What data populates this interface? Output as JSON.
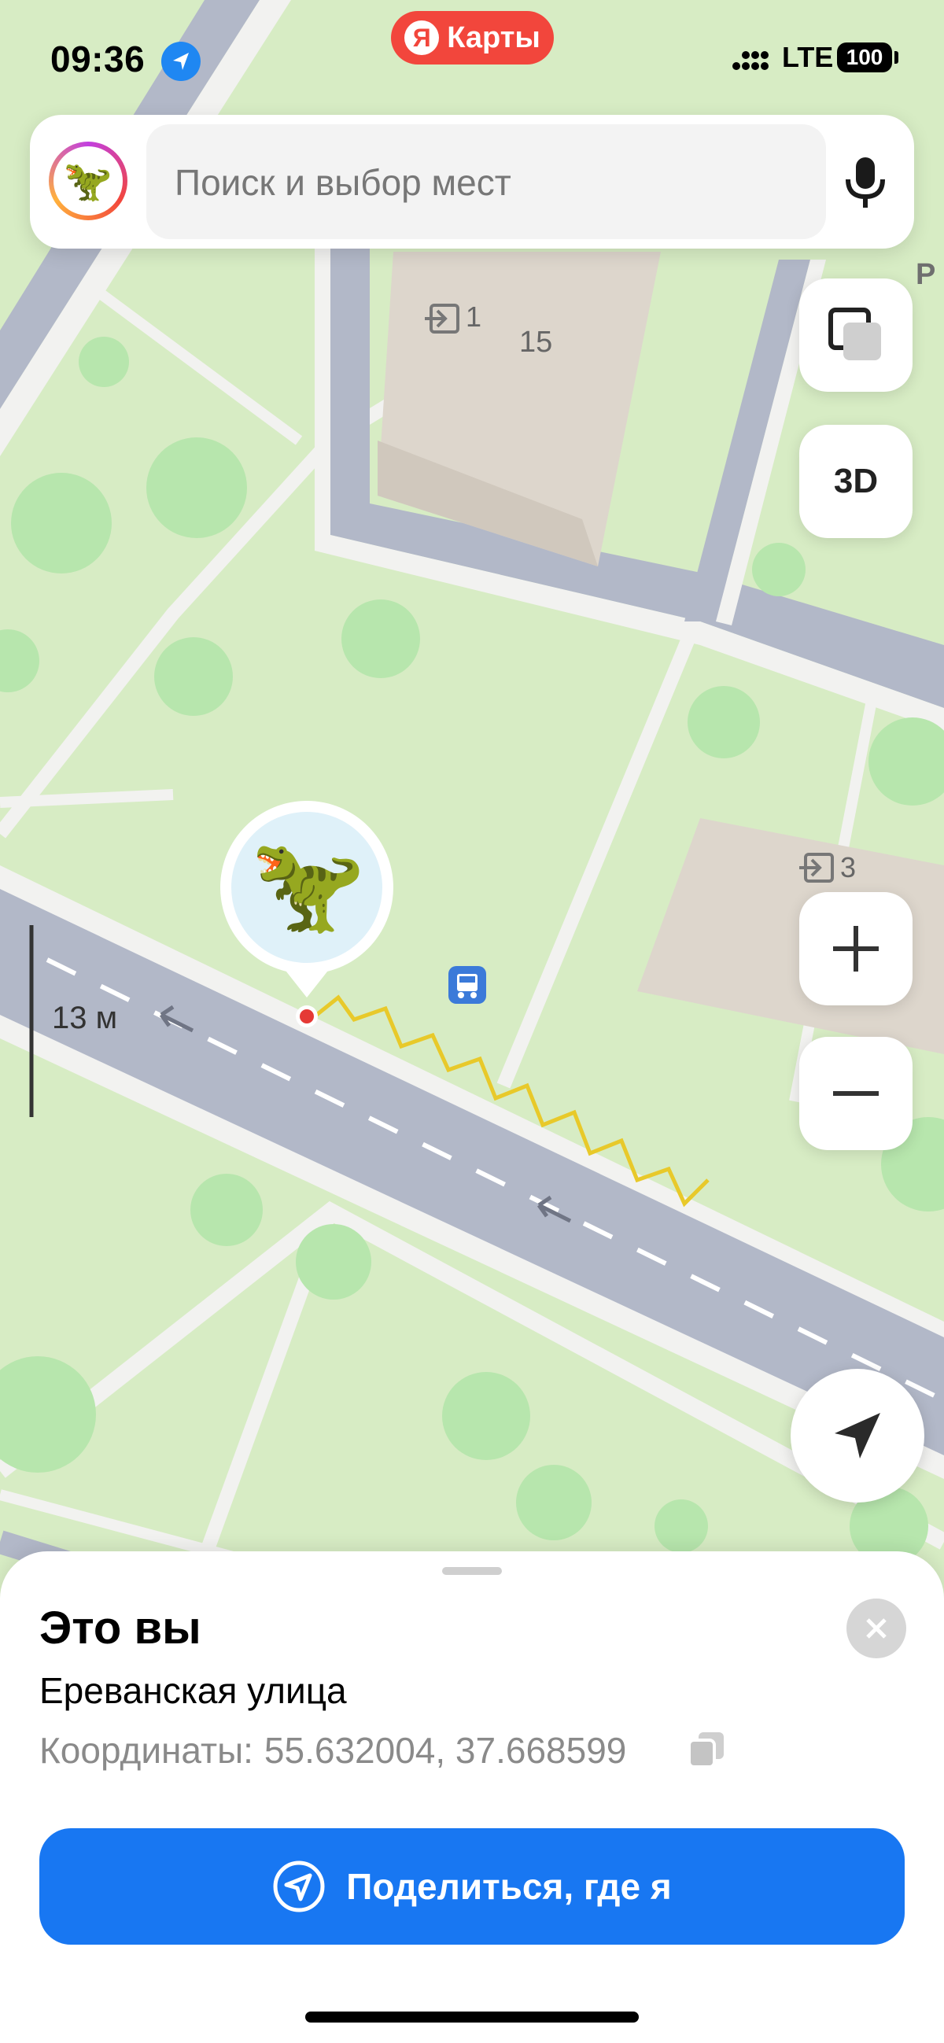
{
  "status_bar": {
    "time": "09:36",
    "network": "LTE",
    "battery": "100"
  },
  "brand": {
    "logo_letter": "Я",
    "name": "Карты"
  },
  "search": {
    "placeholder": "Поиск и выбор мест",
    "avatar_emoji": "🦖"
  },
  "map": {
    "buildings": [
      {
        "number": "15",
        "entrance": "1"
      },
      {
        "entrance": "3"
      }
    ],
    "scale_label": "13 м",
    "user_marker_emoji": "🦖",
    "poi_icon": "bus-stop-icon",
    "parking_label": "P"
  },
  "controls": {
    "layers_icon": "layers-icon",
    "threed_label": "3D",
    "zoom_in_icon": "plus-icon",
    "zoom_out_icon": "minus-icon",
    "locate_icon": "navigation-arrow-icon"
  },
  "sheet": {
    "title": "Это вы",
    "street": "Ереванская улица",
    "coords_label": "Координаты:",
    "coords_value": "55.632004, 37.668599",
    "share_label": "Поделиться, где я"
  },
  "colors": {
    "accent": "#1877f2",
    "brand": "#f2463c",
    "road": "#b2b8c8",
    "park": "#d7ecc4",
    "tree": "#b7e6ad",
    "building": "#ddd6cc"
  }
}
